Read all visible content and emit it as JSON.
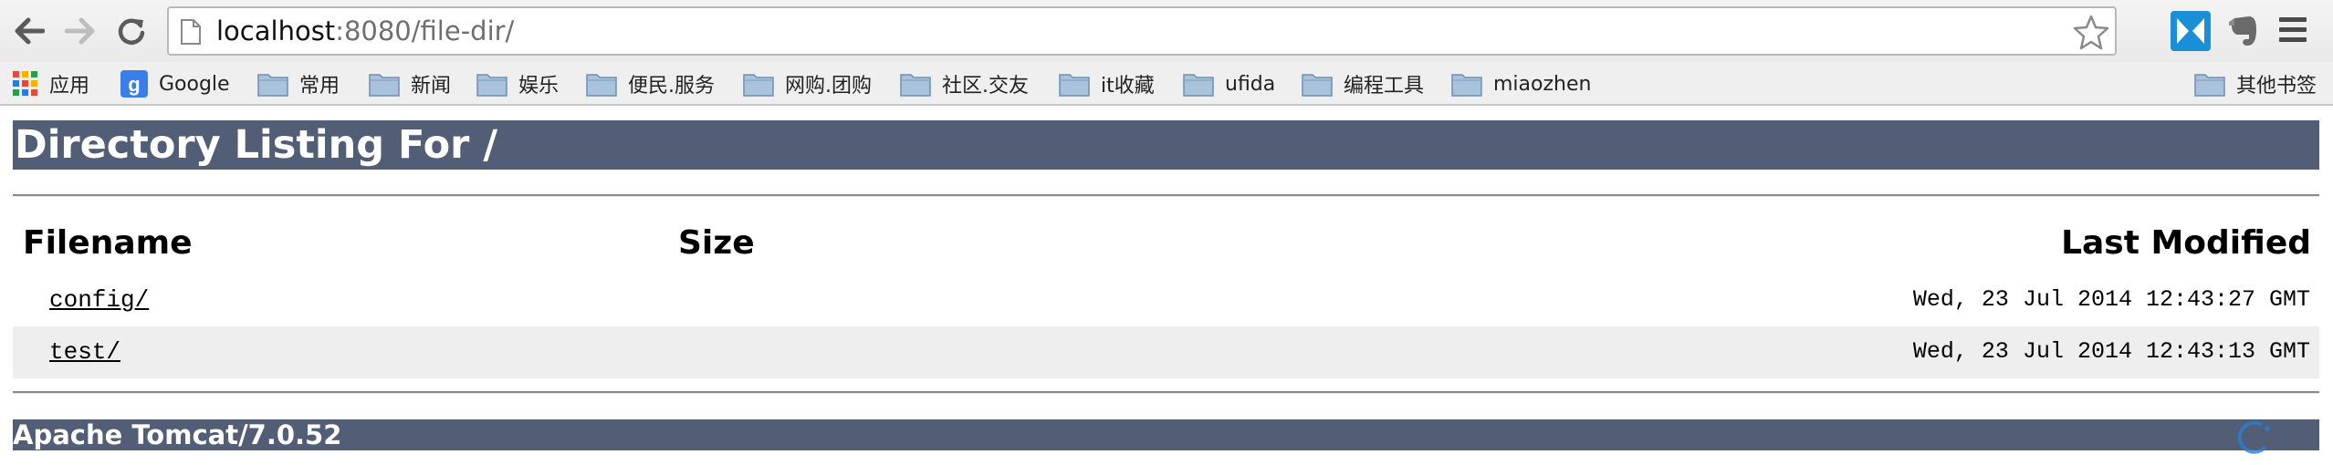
{
  "browser": {
    "url_host": "localhost",
    "url_rest": ":8080/file-dir/",
    "icons": {
      "back": "back-arrow-icon",
      "forward": "forward-arrow-icon",
      "reload": "reload-icon",
      "page": "page-icon",
      "star": "star-icon",
      "menu": "hamburger-menu-icon"
    }
  },
  "bookmarks": {
    "apps_label": "应用",
    "items": [
      {
        "label": "Google",
        "icon": "google-icon"
      },
      {
        "label": "常用",
        "icon": "folder-icon"
      },
      {
        "label": "新闻",
        "icon": "folder-icon"
      },
      {
        "label": "娱乐",
        "icon": "folder-icon"
      },
      {
        "label": "便民.服务",
        "icon": "folder-icon"
      },
      {
        "label": "网购.团购",
        "icon": "folder-icon"
      },
      {
        "label": "社区.交友",
        "icon": "folder-icon"
      },
      {
        "label": "it收藏",
        "icon": "folder-icon"
      },
      {
        "label": "ufida",
        "icon": "folder-icon"
      },
      {
        "label": "编程工具",
        "icon": "folder-icon"
      },
      {
        "label": "miaozhen",
        "icon": "folder-icon"
      }
    ],
    "other_label": "其他书签"
  },
  "page": {
    "heading": "Directory Listing For /",
    "columns": {
      "filename": "Filename",
      "size": "Size",
      "modified": "Last Modified"
    },
    "rows": [
      {
        "name": "config/",
        "size": "",
        "modified": "Wed, 23 Jul 2014 12:43:27 GMT"
      },
      {
        "name": "test/",
        "size": "",
        "modified": "Wed, 23 Jul 2014 12:43:13 GMT"
      }
    ],
    "footer": "Apache Tomcat/7.0.52"
  },
  "colors": {
    "header_bar": "#525d76",
    "alt_row": "#eeeeee"
  }
}
